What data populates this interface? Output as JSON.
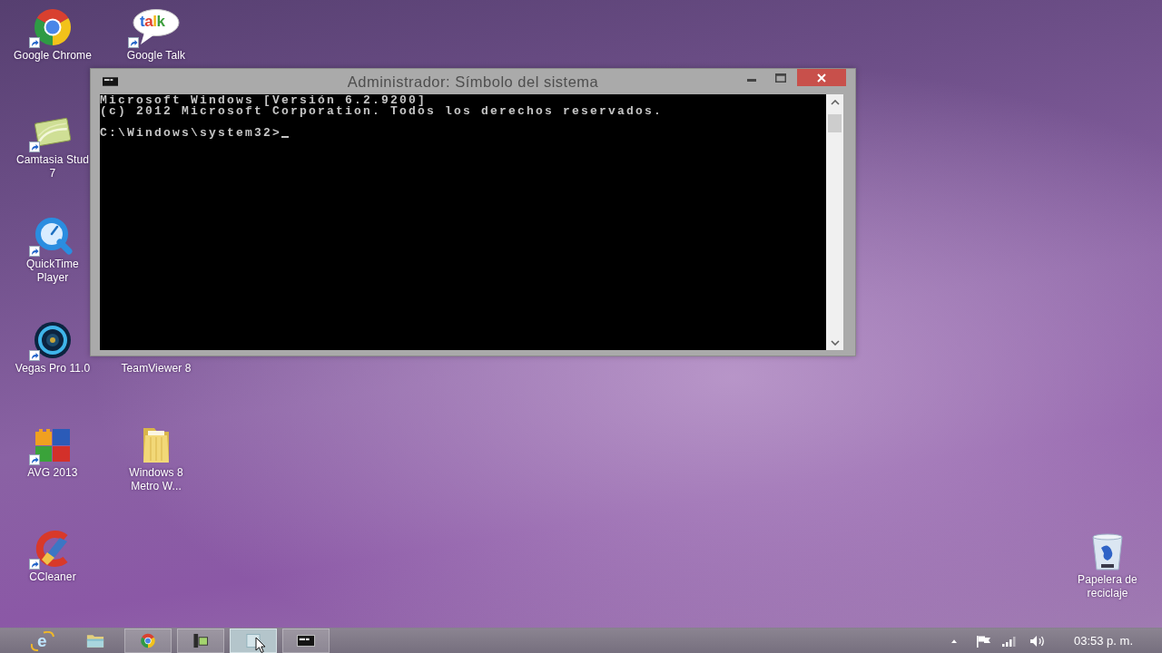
{
  "desktop": {
    "icon_rows": [
      {
        "icons": [
          {
            "label": "Google Chrome",
            "kind": "ring",
            "shortcut": true
          },
          {
            "label": "Google Talk",
            "kind": "bubble",
            "logo_text": "talk",
            "shortcut": true
          }
        ]
      },
      {
        "icons": [
          {
            "label": "Camtasia Stud\n7",
            "kind": "card",
            "shortcut": true
          }
        ]
      },
      {
        "icons": [
          {
            "label": "QuickTime\nPlayer",
            "kind": "dial",
            "shortcut": true
          }
        ]
      },
      {
        "icons": [
          {
            "label": "Vegas Pro 11.0",
            "kind": "disc",
            "shortcut": true
          },
          {
            "label": "TeamViewer 8",
            "kind": "covered",
            "shortcut": false
          }
        ]
      },
      {
        "icons": [
          {
            "label": "AVG 2013",
            "kind": "tiles",
            "shortcut": true
          },
          {
            "label": "Windows 8\nMetro W...",
            "kind": "folder",
            "shortcut": false
          }
        ]
      },
      {
        "icons": [
          {
            "label": "CCleaner",
            "kind": "brush",
            "shortcut": true
          }
        ]
      }
    ],
    "recycle_bin": {
      "label": "Papelera de\nreciclaje",
      "kind": "bin"
    }
  },
  "window": {
    "title": "Administrador: Símbolo del sistema",
    "console": {
      "lines": [
        "Microsoft Windows [Versión 6.2.9200]",
        "(c) 2012 Microsoft Corporation. Todos los derechos reservados."
      ],
      "prompt": "C:\\Windows\\system32>"
    }
  },
  "taskbar": {
    "items": [
      {
        "kind": "e-logo",
        "logo_text": "e",
        "running": false,
        "selected": false
      },
      {
        "kind": "folder",
        "running": false,
        "selected": false
      },
      {
        "kind": "ring",
        "running": true,
        "selected": false
      },
      {
        "kind": "recorder",
        "running": true,
        "selected": false
      },
      {
        "kind": "pane",
        "running": true,
        "selected": true
      },
      {
        "kind": "console",
        "running": true,
        "selected": false
      }
    ],
    "tray": {
      "clock": "03:53 p. m."
    }
  }
}
